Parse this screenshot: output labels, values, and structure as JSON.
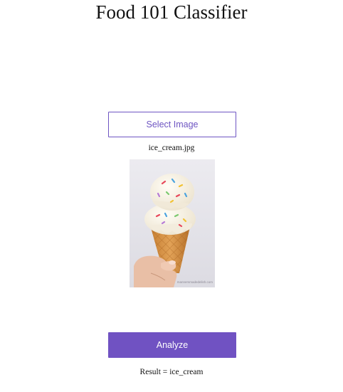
{
  "page": {
    "title": "Food 101 Classifier"
  },
  "uploader": {
    "select_label": "Select Image",
    "file_name": "ice_cream.jpg",
    "image_watermark": "mannersmadedelish.com"
  },
  "actions": {
    "analyze_label": "Analyze"
  },
  "result": {
    "prefix": "Result = ",
    "value": "ice_cream"
  },
  "colors": {
    "accent": "#7052c2",
    "accent_outline": "#6e55c2",
    "text": "#111111",
    "background": "#ffffff"
  }
}
